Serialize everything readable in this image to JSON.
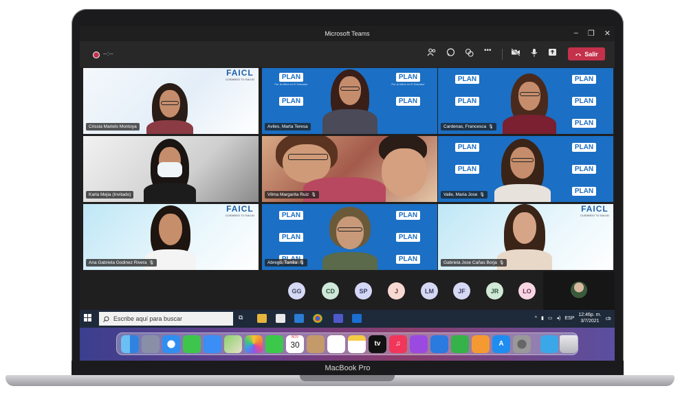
{
  "device": {
    "model_label": "MacBook Pro"
  },
  "window": {
    "title": "Microsoft Teams",
    "minimize": "–",
    "maximize": "❐",
    "close": "✕"
  },
  "toolbar": {
    "recording_time": "--:--",
    "participants_icon": "people-icon",
    "chat_icon": "chat-icon",
    "reactions_icon": "reactions-icon",
    "more_label": "•••",
    "camera_icon": "camera-off-icon",
    "mic_icon": "microphone-icon",
    "share_icon": "share-icon",
    "leave_label": "Salir",
    "leave_color": "#c4314b"
  },
  "participants": [
    {
      "name": "Crissia Marielo Montoya",
      "muted": false,
      "bg": "white"
    },
    {
      "name": "Aviles, Marta Teresa",
      "muted": false,
      "bg": "plan"
    },
    {
      "name": "Cardenas, Francesca",
      "muted": true,
      "bg": "plan"
    },
    {
      "name": "Karla Mejia (Invitado)",
      "muted": false,
      "bg": "room"
    },
    {
      "name": "Vilma Margarita Ruiz",
      "muted": true,
      "bg": "home"
    },
    {
      "name": "Valle, Maria Jose",
      "muted": true,
      "bg": "plan"
    },
    {
      "name": "Ana Gabriela Godinez Rivera",
      "muted": true,
      "bg": "cyan"
    },
    {
      "name": "Abrego, Tamila",
      "muted": true,
      "bg": "plan"
    },
    {
      "name": "Gabriela Jose Cañas Borja",
      "muted": true,
      "bg": "cyan"
    }
  ],
  "backgrounds": {
    "plan_logo": "PLAN",
    "plan_sub": "Por la niñez en El Salvador",
    "brand_main": "FAICL",
    "brand_sub": "CUIDANDO TU SALUD"
  },
  "avatars": [
    {
      "initials": "GG",
      "bg": "#d6d9f4",
      "fg": "#44495e"
    },
    {
      "initials": "CD",
      "bg": "#cfe8d9",
      "fg": "#2f5540"
    },
    {
      "initials": "SP",
      "bg": "#d3d6f5",
      "fg": "#3c3f66"
    },
    {
      "initials": "J",
      "bg": "#f7d9d3",
      "fg": "#6a3a33"
    },
    {
      "initials": "LM",
      "bg": "#d5d8f3",
      "fg": "#3c3f66"
    },
    {
      "initials": "JF",
      "bg": "#d6d9f4",
      "fg": "#3c3f66"
    },
    {
      "initials": "JR",
      "bg": "#d1e9d7",
      "fg": "#2f5540"
    },
    {
      "initials": "LO",
      "bg": "#f7d6e4",
      "fg": "#6a3350"
    }
  ],
  "taskbar": {
    "search_placeholder": "Escribe aquí para buscar",
    "language": "ESP",
    "time": "12:46p. m.",
    "date": "3/7/2021",
    "notification_count": "1"
  },
  "dock": {
    "calendar_month": "NOV",
    "calendar_day": "30",
    "apps": [
      "finder-icon",
      "launchpad-icon",
      "safari-icon",
      "messages-icon",
      "mail-icon",
      "maps-icon",
      "photos-icon",
      "facetime-icon",
      "calendar-icon",
      "contacts-icon",
      "reminders-icon",
      "notes-icon",
      "tv-icon",
      "music-icon",
      "podcasts-icon",
      "keynote-icon",
      "numbers-icon",
      "pages-icon",
      "app-store-icon",
      "system-preferences-icon",
      "folder-icon",
      "trash-icon"
    ],
    "tv_label": "tv"
  }
}
